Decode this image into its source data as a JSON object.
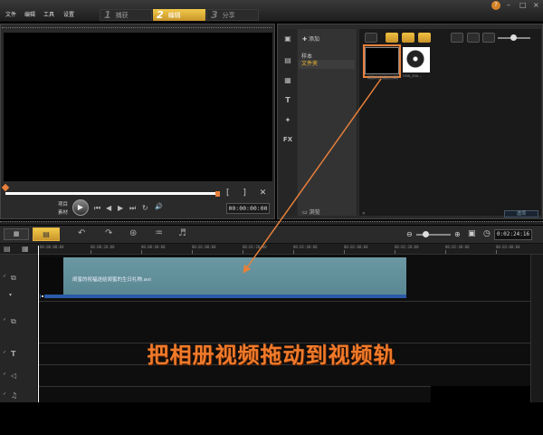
{
  "menu": {
    "items": [
      "文件",
      "编辑",
      "工具",
      "设置"
    ],
    "steps": [
      {
        "num": "1",
        "label": "捕获"
      },
      {
        "num": "2",
        "label": "编辑"
      },
      {
        "num": "3",
        "label": "分享"
      }
    ],
    "active_step": 1,
    "window_controls": [
      "–",
      "□",
      "×"
    ]
  },
  "player": {
    "mode_labels": [
      "项目",
      "素材"
    ],
    "controls": [
      "⏮",
      "◀",
      "▶",
      "⏭",
      "↻",
      "🔊"
    ],
    "timecode": "00:00:00:00"
  },
  "library": {
    "add_label": "添加",
    "nav_items": [
      "样本",
      "文件夹"
    ],
    "selected_nav": 1,
    "browse_label": "浏览",
    "options_label": "选项",
    "clip_caption": "闺蜜的祝福送给闺蜜...",
    "audio_caption": "new_sou..."
  },
  "timeline": {
    "timecode": "0:02:24:16",
    "ruler_ticks": [
      "00:00:00:00",
      "00:00:20:00",
      "00:00:40:00",
      "00:01:00:00",
      "00:01:20:00",
      "00:01:40:00",
      "00:02:00:00",
      "00:02:20:00",
      "00:02:40:00",
      "00:03:00:00"
    ],
    "clip_label": "闺蜜的祝福送给闺蜜的生日礼物.avi"
  },
  "annotation": {
    "text": "把相册视频拖动到视频轨"
  },
  "colors": {
    "accent": "#f0b830",
    "arrow": "#e8803a",
    "clip": "#6b98a2",
    "instruction": "#f07a2a"
  }
}
